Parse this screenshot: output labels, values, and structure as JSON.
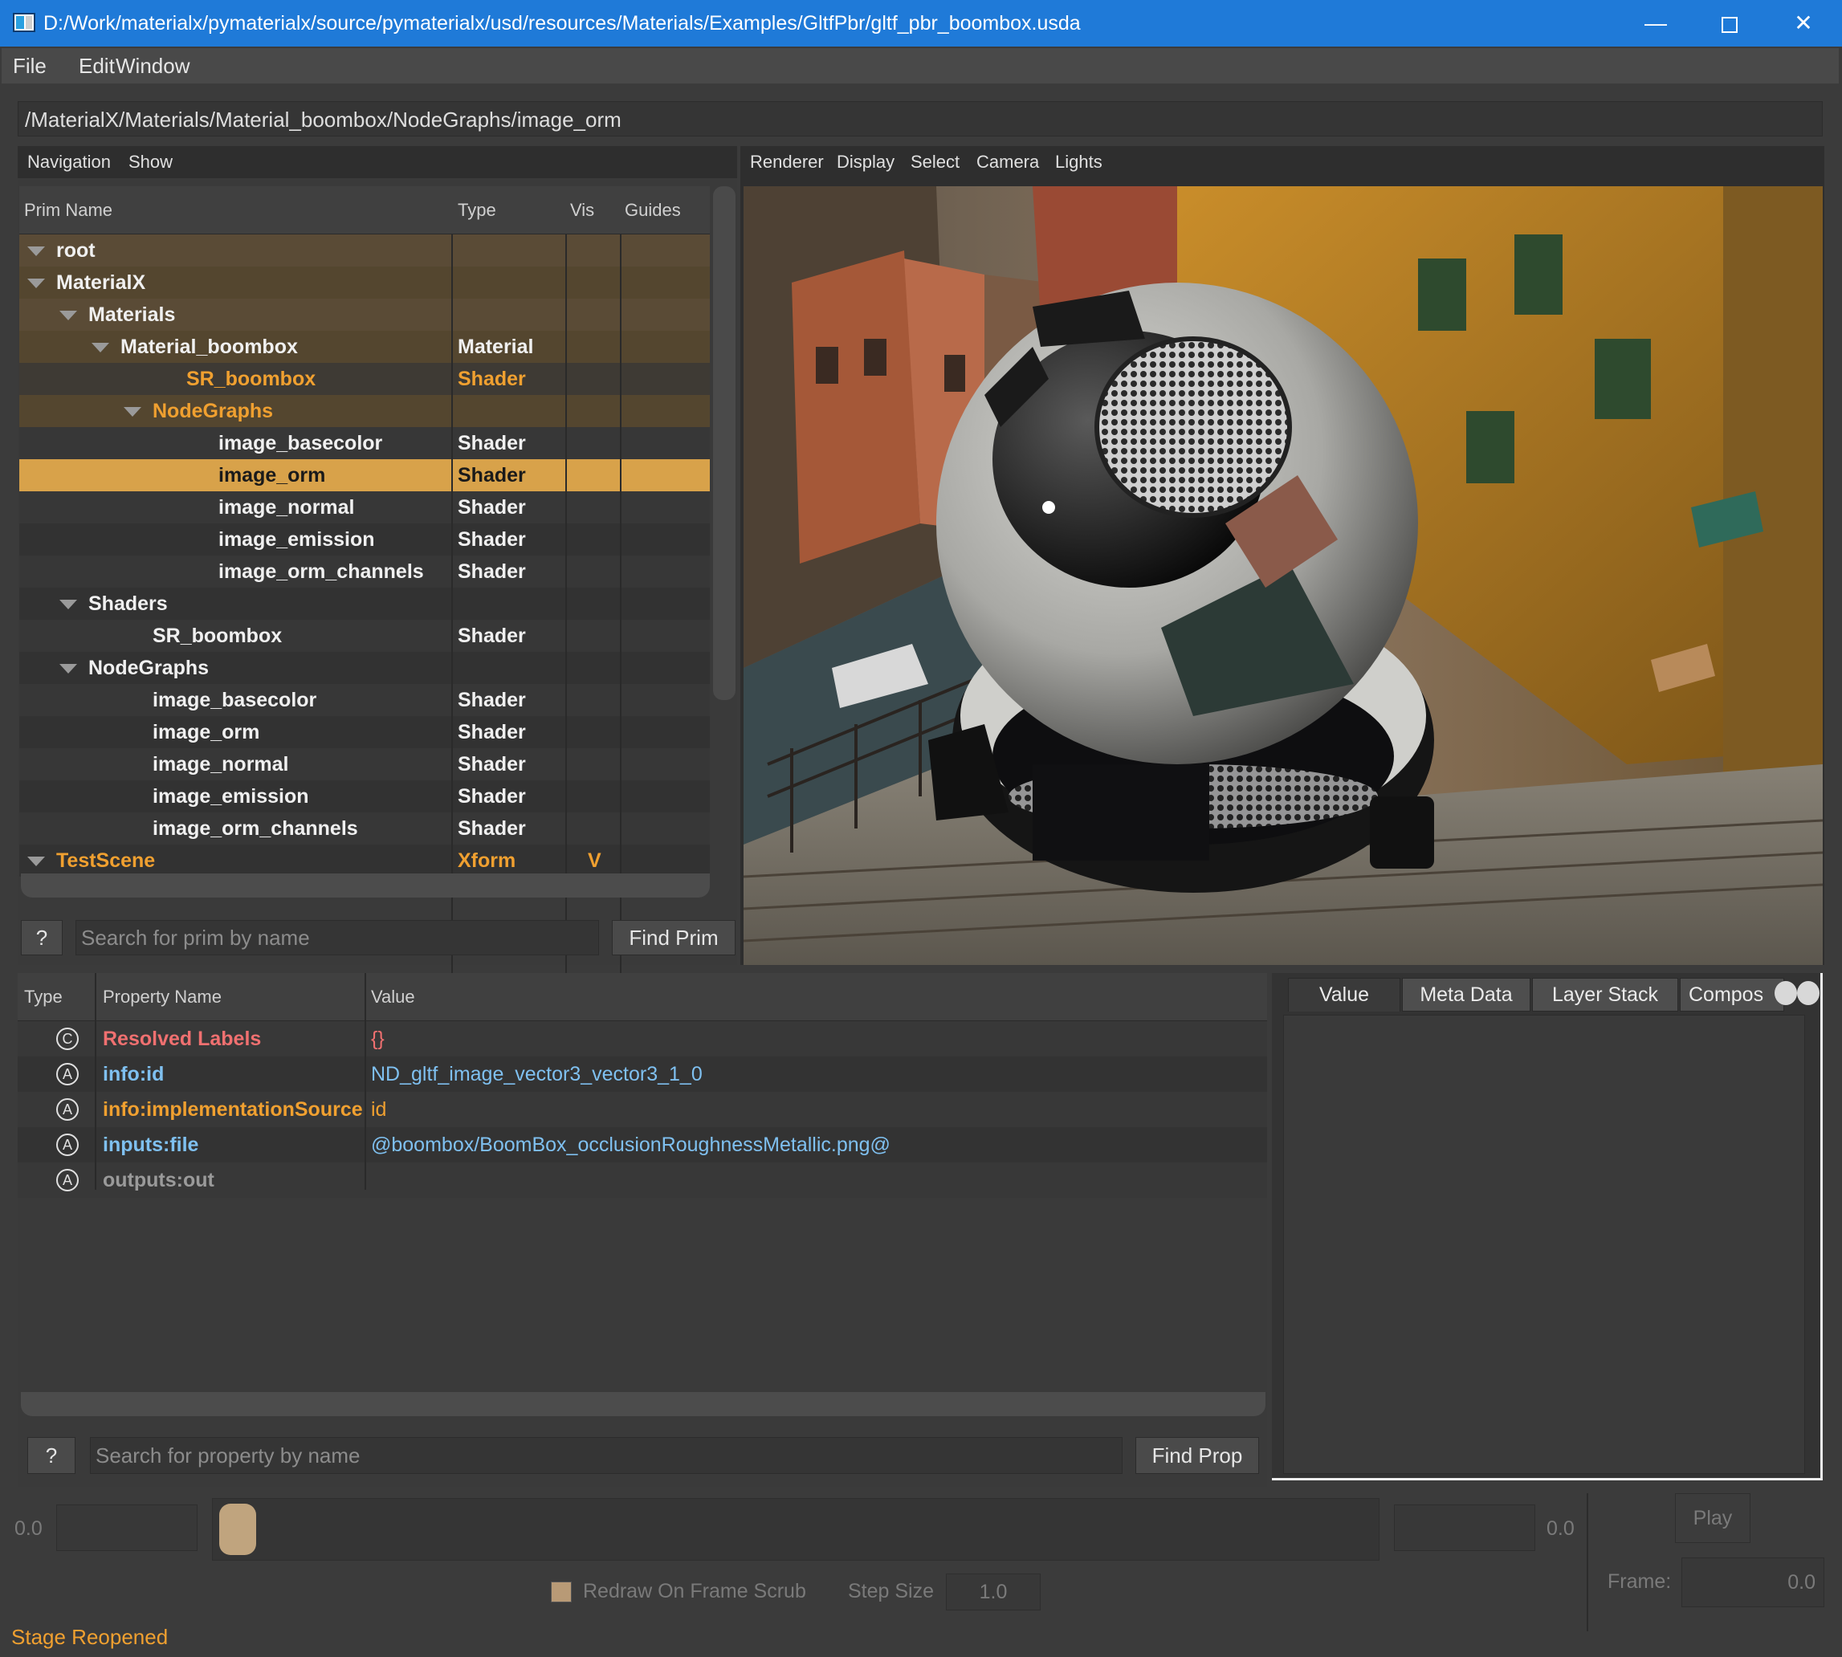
{
  "window": {
    "title": "D:/Work/materialx/pymaterialx/source/pymaterialx/usd/resources/Materials/Examples/GltfPbr/gltf_pbr_boombox.usda",
    "minimize_glyph": "—",
    "close_glyph": "✕"
  },
  "menubar": [
    "File",
    "Edit",
    "Window"
  ],
  "path": "/MaterialX/Materials/Material_boombox/NodeGraphs/image_orm",
  "tree": {
    "menu": [
      "Navigation",
      "Show"
    ],
    "columns": [
      "Prim Name",
      "Type",
      "Vis",
      "Guides"
    ],
    "rows": [
      {
        "name": "root",
        "type": "",
        "vis": ""
      },
      {
        "name": "MaterialX",
        "type": "",
        "vis": ""
      },
      {
        "name": "Materials",
        "type": "",
        "vis": ""
      },
      {
        "name": "Material_boombox",
        "type": "Material",
        "vis": ""
      },
      {
        "name": "SR_boombox",
        "type": "Shader",
        "vis": ""
      },
      {
        "name": "NodeGraphs",
        "type": "",
        "vis": ""
      },
      {
        "name": "image_basecolor",
        "type": "Shader",
        "vis": ""
      },
      {
        "name": "image_orm",
        "type": "Shader",
        "vis": ""
      },
      {
        "name": "image_normal",
        "type": "Shader",
        "vis": ""
      },
      {
        "name": "image_emission",
        "type": "Shader",
        "vis": ""
      },
      {
        "name": "image_orm_channels",
        "type": "Shader",
        "vis": ""
      },
      {
        "name": "Shaders",
        "type": "",
        "vis": ""
      },
      {
        "name": "SR_boombox",
        "type": "Shader",
        "vis": ""
      },
      {
        "name": "NodeGraphs",
        "type": "",
        "vis": ""
      },
      {
        "name": "image_basecolor",
        "type": "Shader",
        "vis": ""
      },
      {
        "name": "image_orm",
        "type": "Shader",
        "vis": ""
      },
      {
        "name": "image_normal",
        "type": "Shader",
        "vis": ""
      },
      {
        "name": "image_emission",
        "type": "Shader",
        "vis": ""
      },
      {
        "name": "image_orm_channels",
        "type": "Shader",
        "vis": ""
      },
      {
        "name": "TestScene",
        "type": "Xform",
        "vis": "V"
      }
    ],
    "help_label": "?",
    "search_placeholder": "Search for prim by name",
    "find_label": "Find Prim"
  },
  "viewport": {
    "menu": [
      "Renderer",
      "Display",
      "Select",
      "Camera",
      "Lights"
    ]
  },
  "properties": {
    "columns": [
      "Type",
      "Property Name",
      "Value"
    ],
    "rows": [
      {
        "icon": "C",
        "name": "Resolved Labels",
        "value": "{}"
      },
      {
        "icon": "A",
        "name": "info:id",
        "value": "ND_gltf_image_vector3_vector3_1_0"
      },
      {
        "icon": "A",
        "name": "info:implementationSource",
        "value": "id"
      },
      {
        "icon": "A",
        "name": "inputs:file",
        "value": "@boombox/BoomBox_occlusionRoughnessMetallic.png@"
      },
      {
        "icon": "A",
        "name": "outputs:out",
        "value": ""
      }
    ],
    "help_label": "?",
    "search_placeholder": "Search for property by name",
    "find_label": "Find Prop"
  },
  "inspector": {
    "tabs": [
      "Value",
      "Meta Data",
      "Layer Stack",
      "Compos"
    ]
  },
  "playback": {
    "start": "0.0",
    "end": "0.0",
    "play_label": "Play",
    "redraw_label": "Redraw On Frame Scrub",
    "step_label": "Step Size",
    "step_value": "1.0",
    "frame_label": "Frame:",
    "frame_value": "0.0"
  },
  "status": "Stage Reopened",
  "colors": {
    "accent_orange": "#f0a030",
    "selected_row": "#d8a24a",
    "attr_blue": "#7fc0f0",
    "label_red": "#f07070",
    "titlebar_blue": "#1f7ad8"
  }
}
